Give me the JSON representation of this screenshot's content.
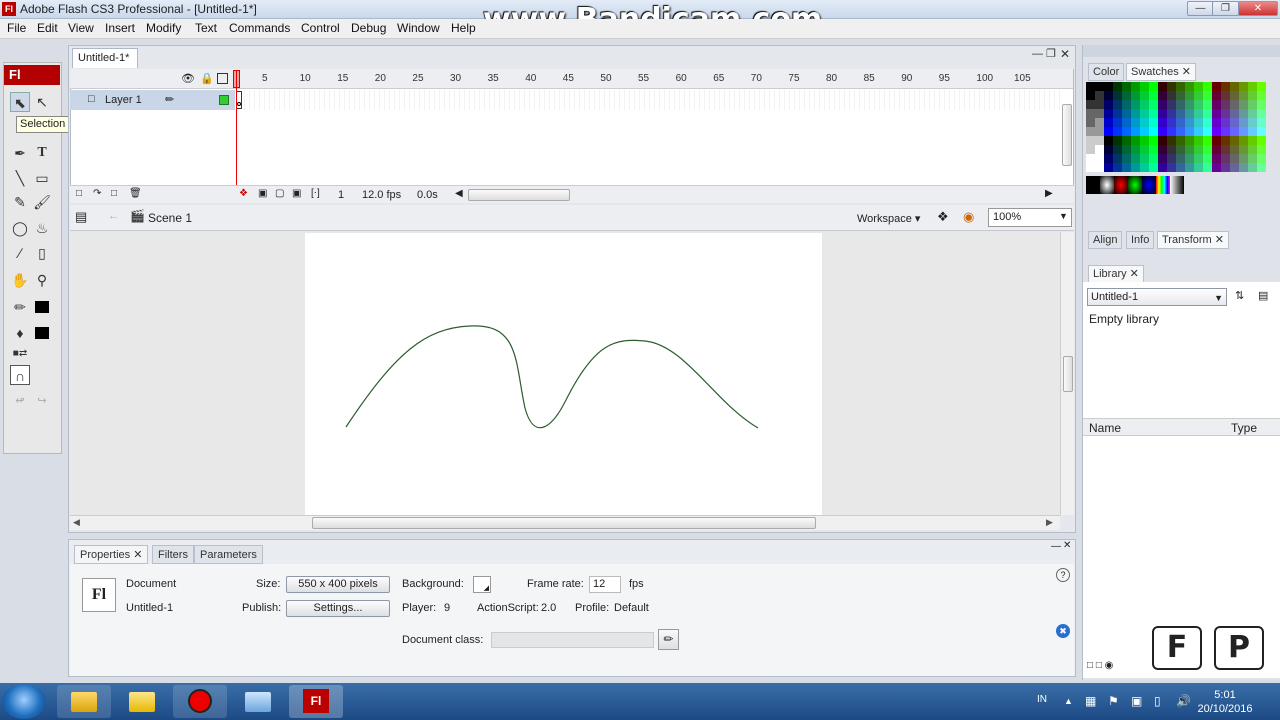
{
  "window": {
    "title": "Adobe Flash CS3 Professional - [Untitled-1*]",
    "app_icon": "Fl"
  },
  "watermark": "www.Bandicam.com",
  "menu": [
    "File",
    "Edit",
    "View",
    "Insert",
    "Modify",
    "Text",
    "Commands",
    "Control",
    "Debug",
    "Window",
    "Help"
  ],
  "toolbox": {
    "logo": "Fl",
    "tooltip": "Selection Tool (V)",
    "tools": [
      "selection-tool",
      "subselection-tool",
      "free-transform-tool",
      "fill-transform-tool",
      "pen-tool",
      "text-tool",
      "line-tool",
      "rectangle-tool",
      "pencil-tool",
      "brush-tool",
      "ink-bottle-tool",
      "paint-bucket-tool",
      "eyedropper-tool",
      "eraser-tool",
      "hand-tool",
      "zoom-tool",
      "stroke-color",
      "fill-color",
      "snap-to-objects"
    ]
  },
  "document": {
    "tab": "Untitled-1*"
  },
  "timeline": {
    "layer_name": "Layer 1",
    "ticks": [
      "5",
      "10",
      "15",
      "20",
      "25",
      "30",
      "35",
      "40",
      "45",
      "50",
      "55",
      "60",
      "65",
      "70",
      "75",
      "80",
      "85",
      "90",
      "95",
      "100",
      "105"
    ],
    "current_frame": "1",
    "frame_rate": "12.0 fps",
    "elapsed": "0.0s"
  },
  "scene": {
    "label": "Scene 1",
    "workspace": "Workspace",
    "zoom": "100%"
  },
  "properties": {
    "tabs": [
      "Properties",
      "Filters",
      "Parameters"
    ],
    "doc_icon": "Fl",
    "doc_type": "Document",
    "doc_name": "Untitled-1",
    "size_label": "Size:",
    "size_value": "550 x 400 pixels",
    "publish_label": "Publish:",
    "settings_button": "Settings...",
    "background_label": "Background:",
    "player_label": "Player:",
    "player_value": "9",
    "actionscript_label": "ActionScript:",
    "actionscript_value": "2.0",
    "profile_label": "Profile:",
    "profile_value": "Default",
    "frame_rate_label": "Frame rate:",
    "frame_rate_value": "12",
    "fps_label": "fps",
    "doc_class_label": "Document class:"
  },
  "right_panels": {
    "color_tabs": [
      "Color",
      "Swatches"
    ],
    "align_tabs": [
      "Align",
      "Info",
      "Transform"
    ],
    "library_tab": "Library",
    "library_doc": "Untitled-1",
    "library_empty": "Empty library",
    "col_name": "Name",
    "col_type": "Type"
  },
  "taskbar": {
    "language": "IN",
    "time": "5:01",
    "date": "20/10/2016",
    "apps": [
      "windows-explorer",
      "folder",
      "bandicam",
      "app-window",
      "flash"
    ]
  },
  "overlay_keys": [
    "F",
    "P"
  ]
}
